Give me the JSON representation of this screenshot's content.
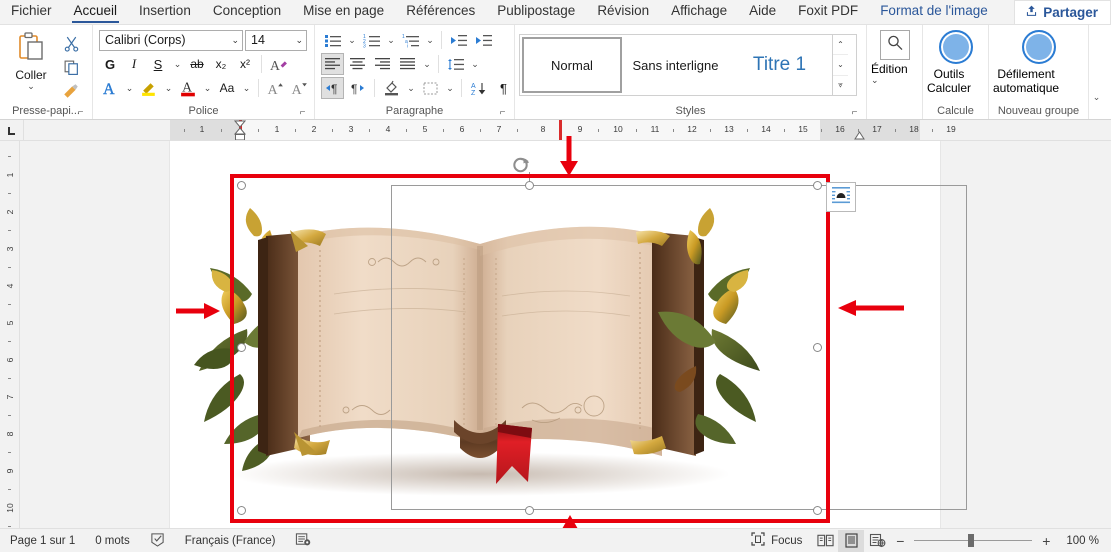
{
  "tabs": [
    {
      "label": "Fichier",
      "state": "normal"
    },
    {
      "label": "Accueil",
      "state": "active"
    },
    {
      "label": "Insertion",
      "state": "normal"
    },
    {
      "label": "Conception",
      "state": "normal"
    },
    {
      "label": "Mise en page",
      "state": "normal"
    },
    {
      "label": "Références",
      "state": "normal"
    },
    {
      "label": "Publipostage",
      "state": "normal"
    },
    {
      "label": "Révision",
      "state": "normal"
    },
    {
      "label": "Affichage",
      "state": "normal"
    },
    {
      "label": "Aide",
      "state": "normal"
    },
    {
      "label": "Foxit PDF",
      "state": "normal"
    },
    {
      "label": "Format de l'image",
      "state": "contextual"
    }
  ],
  "share": {
    "label": "Partager",
    "icon": "share-icon"
  },
  "ribbon": {
    "clipboard": {
      "paste_label": "Coller",
      "group_label": "Presse-papi...",
      "items": [
        "cut-icon",
        "copy-icon",
        "format-painter-icon"
      ]
    },
    "font": {
      "font_name": "Calibri (Corps)",
      "font_size": "14",
      "group_label": "Police",
      "buttons": [
        "G",
        "I",
        "S",
        "ab",
        "x₂",
        "x²",
        "text-effects-icon",
        "font-color-wordart-icon",
        "highlight-icon",
        "font-color-icon",
        "change-case-icon",
        "grow-font-icon",
        "shrink-font-icon"
      ]
    },
    "paragraph": {
      "group_label": "Paragraphe",
      "buttons": [
        "bullets-icon",
        "numbering-icon",
        "multilevel-list-icon",
        "decrease-indent-icon",
        "increase-indent-icon",
        "align-left-icon",
        "align-center-icon",
        "align-right-icon",
        "justify-icon",
        "line-spacing-icon",
        "ltr-text-icon",
        "rtl-text-icon",
        "shading-icon",
        "borders-icon",
        "sort-icon",
        "show-marks-icon"
      ]
    },
    "styles": {
      "group_label": "Styles",
      "items": [
        {
          "label": "Normal",
          "selected": true
        },
        {
          "label": "Sans interligne",
          "selected": false
        },
        {
          "label": "Titre 1",
          "selected": false,
          "heading": true
        }
      ]
    },
    "editing": {
      "label": "Édition",
      "icon": "search-icon"
    },
    "calcule": {
      "group_label": "Calcule",
      "label": "Outils\nCalculer",
      "line1": "Outils",
      "line2": "Calculer"
    },
    "nouveau_groupe": {
      "group_label": "Nouveau groupe",
      "line1": "Défilement",
      "line2": "automatique"
    }
  },
  "ruler": {
    "horizontal_numbers": [
      "1",
      "1",
      "2",
      "3",
      "4",
      "5",
      "6",
      "7",
      "8",
      "9",
      "10",
      "11",
      "12",
      "13",
      "14",
      "15",
      "16",
      "17",
      "18",
      "19"
    ],
    "vertical_numbers": [
      "1",
      "2",
      "3",
      "4",
      "5",
      "6",
      "7",
      "8",
      "9",
      "10"
    ],
    "corner_tab": "L"
  },
  "canvas": {
    "image_alt": "open-book-illustration",
    "layout_options_icon": "layout-options-icon",
    "selection": {
      "handles": 8,
      "rotate_handle": true
    },
    "annotations": [
      {
        "name": "arrow-top",
        "direction": "down"
      },
      {
        "name": "arrow-left",
        "direction": "right"
      },
      {
        "name": "arrow-right",
        "direction": "left"
      },
      {
        "name": "arrow-bottom",
        "direction": "up"
      }
    ],
    "highlight_color": "#e8000d"
  },
  "status": {
    "page": "Page 1 sur 1",
    "words": "0 mots",
    "proofing_icon": "proofing-icon",
    "language": "Français (France)",
    "accessibility_icon": "accessibility-icon",
    "focus": "Focus",
    "views": [
      "read-mode-icon",
      "print-layout-icon",
      "web-layout-icon"
    ],
    "zoom_minus": "−",
    "zoom_plus": "+",
    "zoom_level": "100 %"
  }
}
